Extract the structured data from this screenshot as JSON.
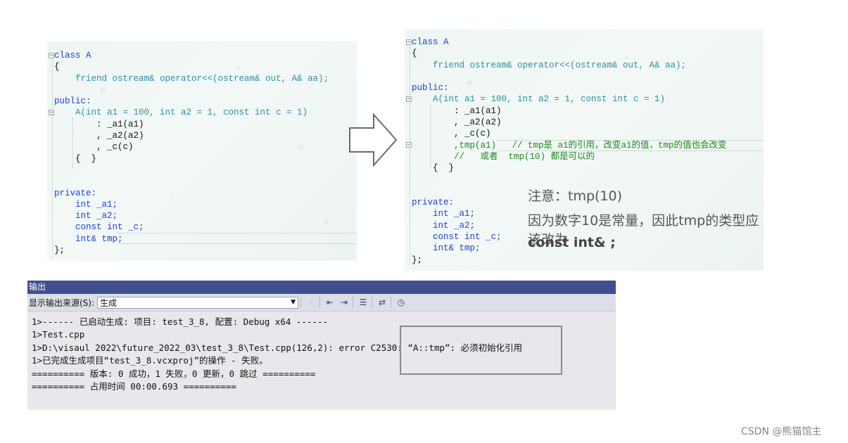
{
  "left_code": {
    "lines": [
      "class A",
      "{",
      "    friend ostream& operator<<(ostream& out, A& aa);",
      "",
      "public:",
      "    A(int a1 = 100, int a2 = 1, const int c = 1)",
      "        : _a1(a1)",
      "        , _a2(a2)",
      "        , _c(c)",
      "    {  }",
      "",
      "",
      "private:",
      "    int _a1;",
      "    int _a2;",
      "    const int _c;",
      "    int& tmp;",
      "};"
    ]
  },
  "right_code": {
    "lines": [
      "class A",
      "{",
      "    friend ostream& operator<<(ostream& out, A& aa);",
      "",
      "public:",
      "    A(int a1 = 100, int a2 = 1, const int c = 1)",
      "        : _a1(a1)",
      "        , _a2(a2)",
      "        , _c(c)",
      "        ,tmp(a1)   // tmp是 a1的引用，改变a1的值，tmp的值也会改变",
      "        //   或者  tmp(10) 都是可以的",
      "    {  }",
      "",
      "",
      "private:",
      "    int _a1;",
      "    int _a2;",
      "    const int _c;",
      "    int& tmp;",
      "};"
    ]
  },
  "note": {
    "line1": "注意：tmp(10)",
    "line2": "因为数字10是常量，因此tmp的类型应该改为",
    "line3": "const int& ;"
  },
  "output": {
    "title": "输出",
    "source_label": "显示输出来源(S):",
    "source_value": "生成",
    "lines": [
      "1>------ 已启动生成: 项目: test_3_8, 配置: Debug x64 ------",
      "1>Test.cpp",
      "1>D:\\visaul 2022\\future_2022_03\\test_3_8\\Test.cpp(126,2): error C2530: “A::tmp”: 必须初始化引用",
      "1>已完成生成项目“test_3_8.vcxproj”的操作 - 失败。",
      "========== 版本: 0 成功，1 失败，0 更新，0 跳过 ==========",
      "========== 占用时间 00:00.693 =========="
    ]
  },
  "watermark": "CSDN @熊猫馆主",
  "colors": {
    "keyword": "#1a3fd6",
    "type": "#2b8fa8",
    "comment": "#1d8a1d",
    "output_title_bar": "#3f4f8f"
  }
}
